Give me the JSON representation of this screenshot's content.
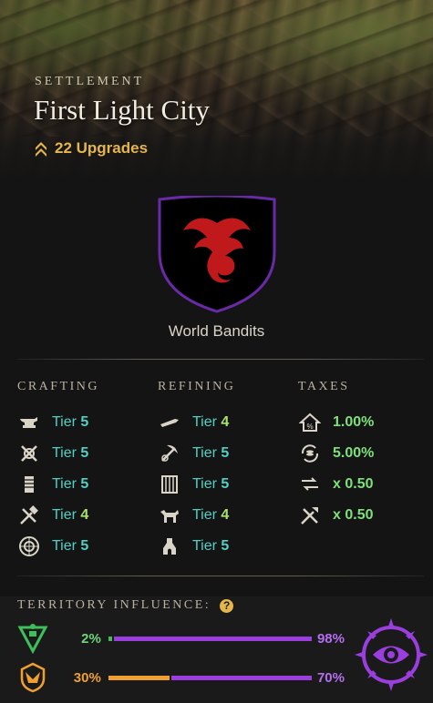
{
  "header": {
    "eyebrow": "SETTLEMENT",
    "title": "First Light City",
    "upgrades_label": "22 Upgrades"
  },
  "company": {
    "name": "World Bandits",
    "shield_color": "#000000",
    "border_color": "#6a2aa8",
    "emblem_color": "#c0191c",
    "emblem_icon": "dragon-icon"
  },
  "crafting": {
    "title": "CRAFTING",
    "items": [
      {
        "icon": "anvil-icon",
        "tier_word": "Tier",
        "tier_num": "5"
      },
      {
        "icon": "crossed-tools-icon",
        "tier_word": "Tier",
        "tier_num": "5"
      },
      {
        "icon": "loom-icon",
        "tier_word": "Tier",
        "tier_num": "5"
      },
      {
        "icon": "hammer-saw-icon",
        "tier_word": "Tier",
        "tier_num": "4"
      },
      {
        "icon": "arcane-circle-icon",
        "tier_word": "Tier",
        "tier_num": "5"
      }
    ]
  },
  "refining": {
    "title": "REFINING",
    "items": [
      {
        "icon": "blade-icon",
        "tier_word": "Tier",
        "tier_num": "4"
      },
      {
        "icon": "pickaxe-icon",
        "tier_word": "Tier",
        "tier_num": "5"
      },
      {
        "icon": "woodshop-icon",
        "tier_word": "Tier",
        "tier_num": "5"
      },
      {
        "icon": "tannery-icon",
        "tier_word": "Tier",
        "tier_num": "4"
      },
      {
        "icon": "smelter-icon",
        "tier_word": "Tier",
        "tier_num": "5"
      }
    ]
  },
  "taxes": {
    "title": "TAXES",
    "items": [
      {
        "icon": "house-tax-icon",
        "value": "1.00%"
      },
      {
        "icon": "coin-cycle-icon",
        "value": "5.00%"
      },
      {
        "icon": "trade-arrows-icon",
        "value": "x 0.50"
      },
      {
        "icon": "crafting-fee-icon",
        "value": "x 0.50"
      }
    ]
  },
  "influence": {
    "title": "TERRITORY INFLUENCE:",
    "help": "?",
    "rows": [
      {
        "faction_icon": "syndicate-icon",
        "left_pct": "2%",
        "right_pct": "98%",
        "left_value": 2,
        "right_value": 98,
        "left_color": "#3fbf5a",
        "right_color": "#9a3ee0"
      },
      {
        "faction_icon": "marauders-icon",
        "left_pct": "30%",
        "right_pct": "70%",
        "left_value": 30,
        "right_value": 70,
        "left_color": "#f0a030",
        "right_color": "#9a3ee0"
      }
    ],
    "owner_emblem": "covenant-eye-icon",
    "owner_color": "#9a3ee0"
  }
}
